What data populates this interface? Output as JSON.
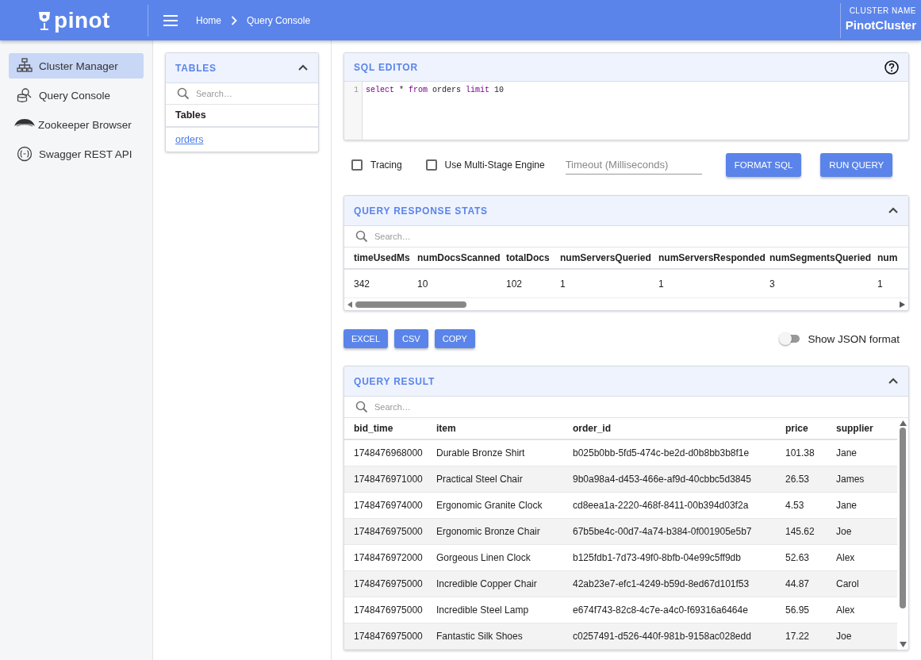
{
  "header": {
    "logo_text": "pinot",
    "breadcrumbs": [
      {
        "label": "Home"
      },
      {
        "label": "Query Console"
      }
    ],
    "cluster_label": "CLUSTER NAME",
    "cluster_name": "PinotCluster"
  },
  "sidebar": {
    "items": [
      {
        "label": "Cluster Manager",
        "selected": true,
        "kind": "cluster"
      },
      {
        "label": "Query Console",
        "selected": false,
        "kind": "query"
      },
      {
        "label": "Zookeeper Browser",
        "selected": false,
        "kind": "zookeeper"
      },
      {
        "label": "Swagger REST API",
        "selected": false,
        "kind": "api"
      }
    ]
  },
  "tables_panel": {
    "title": "TABLES",
    "expanded": true,
    "search": {
      "placeholder": "Search…"
    },
    "column": "Tables",
    "rows": [
      "orders"
    ]
  },
  "sql_editor": {
    "title": "SQL EDITOR",
    "lines": [
      {
        "number": "1",
        "tokens": [
          {
            "text": "select",
            "kind": "keyword"
          },
          {
            "text": " * ",
            "kind": "plain"
          },
          {
            "text": "from",
            "kind": "keyword"
          },
          {
            "text": " orders ",
            "kind": "plain"
          },
          {
            "text": "limit",
            "kind": "keyword"
          },
          {
            "text": " 10",
            "kind": "plain"
          }
        ]
      }
    ]
  },
  "options": {
    "checkboxes": [
      {
        "label": "Tracing",
        "checked": false
      },
      {
        "label": "Use Multi-Stage Engine",
        "checked": false
      }
    ],
    "timeout": {
      "placeholder": "Timeout (Milliseconds)"
    },
    "buttons": [
      "FORMAT SQL",
      "RUN QUERY"
    ]
  },
  "stats": {
    "title": "QUERY RESPONSE STATS",
    "expanded": true,
    "search": {
      "placeholder": "Search…"
    },
    "columns": [
      "timeUsedMs",
      "numDocsScanned",
      "totalDocs",
      "numServersQueried",
      "numServersResponded",
      "numSegmentsQueried",
      "num"
    ],
    "rows": [
      [
        "342",
        "10",
        "102",
        "1",
        "1",
        "3",
        "1"
      ]
    ]
  },
  "export": {
    "buttons": [
      "EXCEL",
      "CSV",
      "COPY"
    ],
    "json_toggle": {
      "label": "Show JSON format",
      "on": false
    }
  },
  "result": {
    "title": "QUERY RESULT",
    "expanded": true,
    "search": {
      "placeholder": "Search…"
    },
    "columns": [
      "bid_time",
      "item",
      "order_id",
      "price",
      "supplier"
    ],
    "rows": [
      [
        "1748476968000",
        "Durable Bronze Shirt",
        "b025b0bb-5fd5-474c-be2d-d0b8bb3b8f1e",
        "101.38",
        "Jane"
      ],
      [
        "1748476971000",
        "Practical Steel Chair",
        "9b0a98a4-d453-466e-af9d-40cbbc5d3845",
        "26.53",
        "James"
      ],
      [
        "1748476974000",
        "Ergonomic Granite Clock",
        "cd8eea1a-2220-468f-8411-00b394d03f2a",
        "4.53",
        "Jane"
      ],
      [
        "1748476975000",
        "Ergonomic Bronze Chair",
        "67b5be4c-00d7-4a74-b384-0f001905e5b7",
        "145.62",
        "Joe"
      ],
      [
        "1748476972000",
        "Gorgeous Linen Clock",
        "b125fdb1-7d73-49f0-8bfb-04e99c5ff9db",
        "52.63",
        "Alex"
      ],
      [
        "1748476975000",
        "Incredible Copper Chair",
        "42ab23e7-efc1-4249-b59d-8ed67d101f53",
        "44.87",
        "Carol"
      ],
      [
        "1748476975000",
        "Incredible Steel Lamp",
        "e674f743-82c8-4c7e-a4c0-f69316a6464e",
        "56.95",
        "Alex"
      ],
      [
        "1748476975000",
        "Fantastic Silk Shoes",
        "c0257491-d526-440f-981b-9158ac028edd",
        "17.22",
        "Joe"
      ]
    ]
  }
}
